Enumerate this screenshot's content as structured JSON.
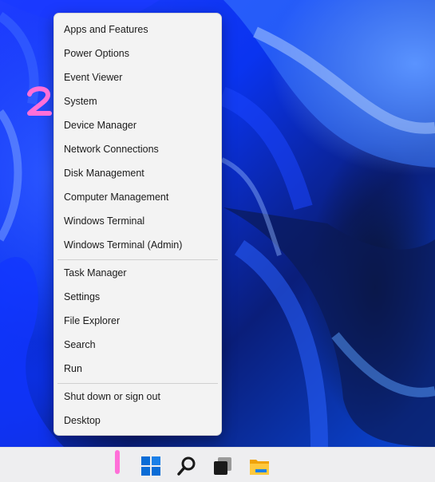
{
  "context_menu": {
    "items": [
      {
        "label": "Apps and Features"
      },
      {
        "label": "Power Options"
      },
      {
        "label": "Event Viewer"
      },
      {
        "label": "System"
      },
      {
        "label": "Device Manager"
      },
      {
        "label": "Network Connections"
      },
      {
        "label": "Disk Management"
      },
      {
        "label": "Computer Management"
      },
      {
        "label": "Windows Terminal"
      },
      {
        "label": "Windows Terminal (Admin)"
      },
      {
        "label": "Task Manager"
      },
      {
        "label": "Settings"
      },
      {
        "label": "File Explorer"
      },
      {
        "label": "Search"
      },
      {
        "label": "Run"
      },
      {
        "label": "Shut down or sign out"
      },
      {
        "label": "Desktop"
      }
    ]
  },
  "annotations": {
    "step_1": "1",
    "step_2": "2",
    "color": "#ff6fd8"
  },
  "taskbar": {
    "icons": [
      "windows-start-icon",
      "search-icon",
      "task-view-icon",
      "file-explorer-icon"
    ],
    "accent": "#0067c0"
  }
}
